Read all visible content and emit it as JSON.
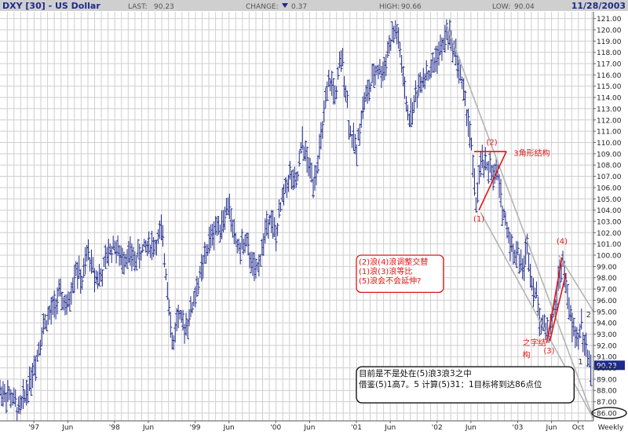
{
  "header": {
    "symbol": "DXY [30] - US Dollar",
    "last_label": "LAST:",
    "last_value": "90.23",
    "change_label": "CHANGE:",
    "change_value": "0.37",
    "change_direction": "down",
    "high_label": "HIGH:",
    "high_value": "90.66",
    "low_label": "LOW:",
    "low_value": "90.04",
    "date": "11/28/2003"
  },
  "colors": {
    "header_bg": "#cfcfcf",
    "grid": "#cfcfcf",
    "bars": "#1f2a8c",
    "channel": "#b4b4b4",
    "annotation": "#e01515",
    "last_tag_bg": "#1f2a8c"
  },
  "chart_data": {
    "type": "bar",
    "subtype": "ohlc-weekly",
    "title": "DXY [30] - US Dollar",
    "ylim": [
      85.3,
      121.6
    ],
    "y_ticks": [
      86,
      87,
      88,
      89,
      90,
      91,
      92,
      93,
      94,
      95,
      96,
      97,
      98,
      99,
      100,
      101,
      102,
      103,
      104,
      105,
      106,
      107,
      108,
      109,
      110,
      111,
      112,
      113,
      114,
      115,
      116,
      117,
      118,
      119,
      120,
      121
    ],
    "x_ticks": [
      "'97",
      "Jun",
      "'98",
      "Jun",
      "'99",
      "Jun",
      "'00",
      "Jun",
      "'01",
      "Jun",
      "'02",
      "Jun",
      "'03",
      "Jun",
      "Oct"
    ],
    "x_ticks_t": [
      1997.0,
      1997.42,
      1998.0,
      1998.42,
      1999.0,
      1999.42,
      2000.0,
      2000.42,
      2001.0,
      2001.42,
      2002.0,
      2002.42,
      2003.0,
      2003.42,
      2003.75
    ],
    "xlim": [
      1996.58,
      2003.94
    ],
    "period_label": "Weekly",
    "last_tag": "90.23",
    "grid": true,
    "price_path": [
      [
        1996.58,
        88.0
      ],
      [
        1996.72,
        87.4
      ],
      [
        1996.82,
        86.2
      ],
      [
        1996.92,
        88.2
      ],
      [
        1997.02,
        90.5
      ],
      [
        1997.12,
        93.8
      ],
      [
        1997.22,
        95.0
      ],
      [
        1997.32,
        96.5
      ],
      [
        1997.42,
        95.2
      ],
      [
        1997.52,
        99.0
      ],
      [
        1997.6,
        97.6
      ],
      [
        1997.67,
        100.4
      ],
      [
        1997.75,
        98.3
      ],
      [
        1997.83,
        98.0
      ],
      [
        1997.92,
        100.2
      ],
      [
        1998.0,
        101.0
      ],
      [
        1998.08,
        99.6
      ],
      [
        1998.17,
        100.2
      ],
      [
        1998.25,
        99.5
      ],
      [
        1998.33,
        100.3
      ],
      [
        1998.42,
        101.0
      ],
      [
        1998.5,
        100.8
      ],
      [
        1998.58,
        102.1
      ],
      [
        1998.64,
        98.5
      ],
      [
        1998.69,
        95.0
      ],
      [
        1998.72,
        91.5
      ],
      [
        1998.78,
        94.8
      ],
      [
        1998.85,
        93.6
      ],
      [
        1998.92,
        94.3
      ],
      [
        1999.0,
        96.5
      ],
      [
        1999.08,
        98.6
      ],
      [
        1999.17,
        101.0
      ],
      [
        1999.25,
        102.5
      ],
      [
        1999.33,
        102.8
      ],
      [
        1999.42,
        104.6
      ],
      [
        1999.47,
        102.0
      ],
      [
        1999.55,
        100.5
      ],
      [
        1999.62,
        101.2
      ],
      [
        1999.7,
        99.4
      ],
      [
        1999.75,
        98.2
      ],
      [
        1999.83,
        100.5
      ],
      [
        1999.92,
        103.8
      ],
      [
        2000.0,
        101.5
      ],
      [
        2000.08,
        105.0
      ],
      [
        2000.17,
        107.2
      ],
      [
        2000.25,
        106.0
      ],
      [
        2000.33,
        110.0
      ],
      [
        2000.4,
        108.0
      ],
      [
        2000.47,
        106.6
      ],
      [
        2000.55,
        109.5
      ],
      [
        2000.6,
        112.4
      ],
      [
        2000.67,
        115.6
      ],
      [
        2000.75,
        114.0
      ],
      [
        2000.79,
        116.8
      ],
      [
        2000.83,
        117.2
      ],
      [
        2000.88,
        114.0
      ],
      [
        2000.92,
        111.0
      ],
      [
        2000.97,
        110.0
      ],
      [
        2001.0,
        109.0
      ],
      [
        2001.04,
        111.5
      ],
      [
        2001.1,
        113.8
      ],
      [
        2001.17,
        114.8
      ],
      [
        2001.25,
        116.6
      ],
      [
        2001.33,
        116.2
      ],
      [
        2001.4,
        118.5
      ],
      [
        2001.46,
        119.6
      ],
      [
        2001.5,
        120.0
      ],
      [
        2001.57,
        116.5
      ],
      [
        2001.62,
        113.0
      ],
      [
        2001.67,
        112.2
      ],
      [
        2001.75,
        114.5
      ],
      [
        2001.83,
        116.0
      ],
      [
        2001.92,
        116.2
      ],
      [
        2002.0,
        117.8
      ],
      [
        2002.08,
        118.5
      ],
      [
        2002.12,
        120.0
      ],
      [
        2002.17,
        119.0
      ],
      [
        2002.23,
        118.0
      ],
      [
        2002.29,
        116.0
      ],
      [
        2002.35,
        113.5
      ],
      [
        2002.4,
        111.5
      ],
      [
        2002.45,
        107.5
      ],
      [
        2002.48,
        104.5
      ],
      [
        2002.52,
        106.5
      ],
      [
        2002.56,
        108.5
      ],
      [
        2002.62,
        107.5
      ],
      [
        2002.66,
        108.3
      ],
      [
        2002.7,
        106.5
      ],
      [
        2002.75,
        107.5
      ],
      [
        2002.79,
        105.0
      ],
      [
        2002.85,
        103.0
      ],
      [
        2002.9,
        101.5
      ],
      [
        2002.96,
        100.0
      ],
      [
        2003.0,
        100.5
      ],
      [
        2003.06,
        98.5
      ],
      [
        2003.12,
        101.0
      ],
      [
        2003.17,
        98.0
      ],
      [
        2003.24,
        96.0
      ],
      [
        2003.29,
        94.0
      ],
      [
        2003.33,
        93.6
      ],
      [
        2003.38,
        93.2
      ],
      [
        2003.44,
        94.5
      ],
      [
        2003.48,
        96.0
      ],
      [
        2003.52,
        98.5
      ],
      [
        2003.56,
        99.2
      ],
      [
        2003.6,
        97.5
      ],
      [
        2003.64,
        95.0
      ],
      [
        2003.68,
        93.5
      ],
      [
        2003.71,
        93.0
      ],
      [
        2003.75,
        92.5
      ],
      [
        2003.79,
        94.0
      ],
      [
        2003.83,
        92.0
      ],
      [
        2003.87,
        91.0
      ],
      [
        2003.91,
        90.23
      ]
    ],
    "channel_lines": [
      [
        [
          2002.12,
          120.4
        ],
        [
          2003.94,
          85.5
        ]
      ],
      [
        [
          2002.54,
          103.8
        ],
        [
          2003.94,
          85.5
        ]
      ],
      [
        [
          2003.51,
          100.0
        ],
        [
          2003.94,
          95.0
        ]
      ]
    ],
    "triangle_segments": [
      [
        [
          2002.46,
          109.2
        ],
        [
          2002.86,
          109.2
        ]
      ],
      [
        [
          2002.52,
          104.0
        ],
        [
          2002.86,
          109.2
        ]
      ]
    ],
    "wave4_segments": [
      [
        [
          2003.36,
          92.2
        ],
        [
          2003.55,
          99.8
        ]
      ],
      [
        [
          2003.4,
          92.4
        ],
        [
          2003.6,
          98.4
        ]
      ]
    ],
    "annotations": [
      {
        "id": "w2",
        "text": "(2)",
        "t": 2002.68,
        "v": 109.8,
        "anchor": "middle"
      },
      {
        "id": "tri",
        "text": "3角形结构",
        "t": 2002.95,
        "v": 108.8,
        "anchor": "start"
      },
      {
        "id": "w1",
        "text": "(1)",
        "t": 2002.52,
        "v": 103.0,
        "anchor": "middle"
      },
      {
        "id": "w4",
        "text": "(4)",
        "t": 2003.55,
        "v": 101.0,
        "anchor": "middle"
      },
      {
        "id": "w3",
        "text": "(3)",
        "t": 2003.39,
        "v": 91.3,
        "anchor": "middle"
      },
      {
        "id": "zhi1",
        "text": "之字结",
        "t": 2003.06,
        "v": 92.0,
        "anchor": "start"
      },
      {
        "id": "zhi2",
        "text": "构",
        "t": 2003.06,
        "v": 90.9,
        "anchor": "start"
      },
      {
        "id": "sub1",
        "text": "1",
        "t": 2003.78,
        "v": 90.3,
        "anchor": "middle",
        "color": "#333333"
      },
      {
        "id": "sub2",
        "text": "2",
        "t": 2003.88,
        "v": 94.5,
        "anchor": "middle",
        "color": "#333333"
      }
    ],
    "red_note": {
      "lines": [
        "(2)浪(4)浪调整交替",
        "(1)浪(3)浪等比",
        "(5)浪会不会延伸?"
      ],
      "t": 2001.0,
      "v": 100.0,
      "t2": 2002.08,
      "v2": 96.7
    },
    "black_note": {
      "lines": [
        "目前是不是处在(5)浪3浪3之中",
        "借鉴(5)1高7。5  计算(5)31：1目标将到达86点位"
      ],
      "t": 2001.0,
      "v": 90.1,
      "t2": 2003.7,
      "v2": 86.9
    },
    "target_oval": {
      "text": "86.00",
      "v": 86.0
    }
  }
}
